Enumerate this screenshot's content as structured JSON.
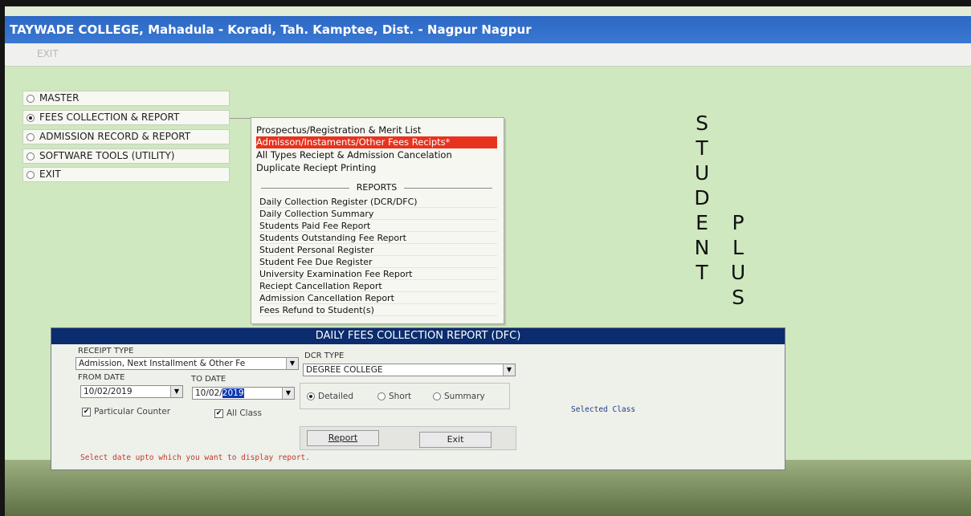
{
  "window": {
    "title": "TAYWADE COLLEGE, Mahadula - Koradi, Tah. Kamptee, Dist. - Nagpur Nagpur"
  },
  "menubar": {
    "exit_label": "EXIT"
  },
  "main_menu": [
    {
      "label": "MASTER",
      "selected": false
    },
    {
      "label": "FEES COLLECTION & REPORT",
      "selected": true
    },
    {
      "label": "ADMISSION RECORD & REPORT",
      "selected": false
    },
    {
      "label": "SOFTWARE TOOLS (UTILITY)",
      "selected": false
    },
    {
      "label": "EXIT",
      "selected": false
    }
  ],
  "submenu": {
    "items": [
      "Prospectus/Registration & Merit List",
      "Admisson/Instaments/Other Fees Recipts*",
      "All Types Reciept & Admission Cancelation",
      "Duplicate Reciept Printing"
    ],
    "selected_index": 1,
    "reports_header": "REPORTS",
    "reports": [
      "Daily Collection Register (DCR/DFC)",
      "Daily Collection Summary",
      "Students Paid Fee Report",
      "Students Outstanding Fee Report",
      "Student Personal Register",
      "Student Fee Due Register",
      "University Examination Fee Report",
      "Reciept Cancellation Report",
      "Admission Cancellation Report",
      "Fees Refund to Student(s)"
    ]
  },
  "branding": {
    "word1": [
      "S",
      "T",
      "U",
      "D",
      "E",
      "N",
      "T"
    ],
    "word2": [
      "P",
      "L",
      "U",
      "S"
    ]
  },
  "dfc_dialog": {
    "title": "DAILY FEES COLLECTION REPORT (DFC)",
    "receipt_type_label": "RECEIPT TYPE",
    "receipt_type_value": "Admission, Next Installment & Other Fe",
    "dcr_type_label": "DCR TYPE",
    "dcr_type_value": "DEGREE COLLEGE",
    "from_date_label": "FROM DATE",
    "from_date_value": "10/02/2019",
    "to_date_label": "TO DATE",
    "to_date_prefix": "10/02/",
    "to_date_year_selected": "2019",
    "report_options": [
      {
        "label": "Detailed",
        "selected": true
      },
      {
        "label": "Short",
        "selected": false
      },
      {
        "label": "Summary",
        "selected": false
      }
    ],
    "particular_counter_label": "Particular Counter",
    "particular_counter_checked": true,
    "all_class_label": "All Class",
    "all_class_checked": true,
    "selected_class_label": "Selected Class",
    "report_button": "Report",
    "exit_button": "Exit",
    "status_text": "Select date upto which you want to display report."
  },
  "colors": {
    "title_bar": "#3a78d2",
    "background": "#cfe8bf",
    "menu_highlight": "#e7331d",
    "dialog_title": "#0b2c6e"
  }
}
